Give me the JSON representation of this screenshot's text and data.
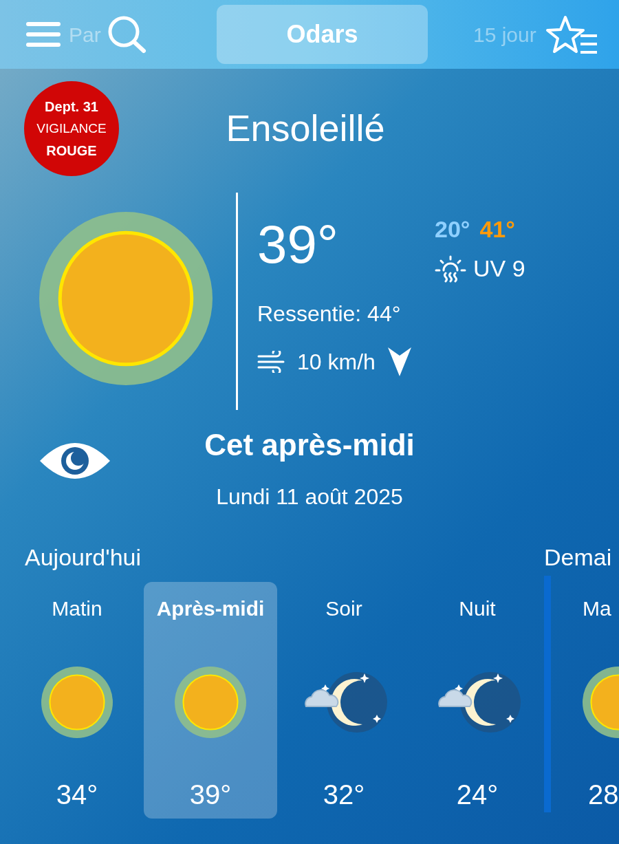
{
  "top_bar": {
    "tabs": [
      {
        "label": "Par",
        "selected": false
      },
      {
        "label": "Odars",
        "selected": true
      },
      {
        "label": "15 jour",
        "selected": false
      }
    ]
  },
  "alert": {
    "dept": "Dept. 31",
    "line": "VIGILANCE",
    "level": "ROUGE"
  },
  "condition": "Ensoleillé",
  "current": {
    "temp": "39°",
    "min": "20°",
    "max": "41°",
    "uv": "UV 9",
    "feels": "Ressentie: 44°",
    "wind": "10 km/h"
  },
  "period": {
    "title": "Cet après-midi",
    "date": "Lundi 11 août 2025"
  },
  "days": [
    {
      "label": "Aujourd'hui",
      "parts": [
        {
          "label": "Matin",
          "kind": "sun",
          "temp": "34°",
          "selected": false
        },
        {
          "label": "Après-midi",
          "kind": "sun",
          "temp": "39°",
          "selected": true
        },
        {
          "label": "Soir",
          "kind": "moon",
          "temp": "32°",
          "selected": false
        },
        {
          "label": "Nuit",
          "kind": "moon",
          "temp": "24°",
          "selected": false
        }
      ]
    },
    {
      "label": "Demai",
      "parts": [
        {
          "label": "Ma",
          "kind": "sun",
          "temp": "28",
          "selected": false
        }
      ]
    }
  ]
}
